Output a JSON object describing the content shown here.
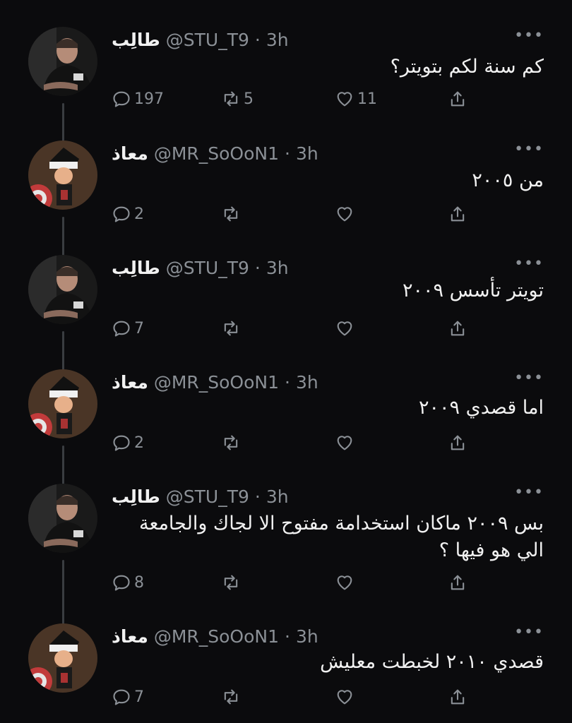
{
  "tweets": [
    {
      "name": "طالِب",
      "handle": "@STU_T9",
      "time": "3h",
      "text": "كم سنة لكم بتويتر؟",
      "replies": "197",
      "retweets": "5",
      "likes": "11",
      "avatar": "man-photo"
    },
    {
      "name": "معاذ",
      "handle": "@MR_SoOoN1",
      "time": "3h",
      "text": "من ٢٠٠٥",
      "replies": "2",
      "retweets": "",
      "likes": "",
      "avatar": "cartoon-character"
    },
    {
      "name": "طالِب",
      "handle": "@STU_T9",
      "time": "3h",
      "text": "تويتر تأسس ٢٠٠٩",
      "replies": "7",
      "retweets": "",
      "likes": "",
      "avatar": "man-photo"
    },
    {
      "name": "معاذ",
      "handle": "@MR_SoOoN1",
      "time": "3h",
      "text": "اما قصدي ٢٠٠٩",
      "replies": "2",
      "retweets": "",
      "likes": "",
      "avatar": "cartoon-character"
    },
    {
      "name": "طالِب",
      "handle": "@STU_T9",
      "time": "3h",
      "text": "بس ٢٠٠٩ ماكان استخدامة مفتوح الا لجاك والجامعة الي هو فيها ؟",
      "replies": "8",
      "retweets": "",
      "likes": "",
      "avatar": "man-photo"
    },
    {
      "name": "معاذ",
      "handle": "@MR_SoOoN1",
      "time": "3h",
      "text": "قصدي ٢٠١٠ لخبطت معليش",
      "replies": "7",
      "retweets": "",
      "likes": "",
      "avatar": "cartoon-character"
    }
  ],
  "separator": "·",
  "more_glyph": "•••",
  "colors": {
    "background": "#0b0b0d",
    "muted": "#8b9096",
    "text": "#f1f1f1",
    "thread_line": "#3a3d41"
  }
}
